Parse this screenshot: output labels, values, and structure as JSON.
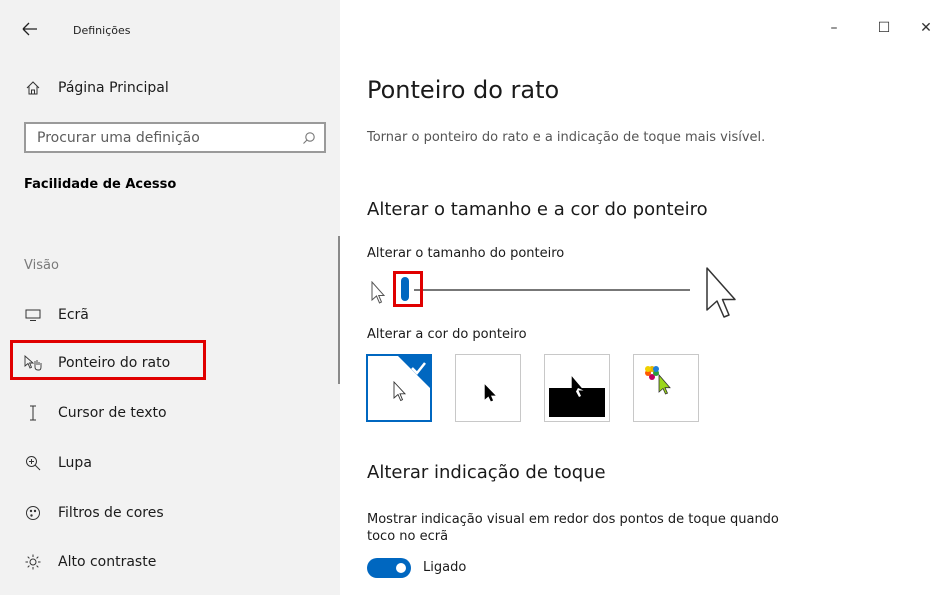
{
  "window": {
    "title": "Definições",
    "controls": {
      "minimize": "–",
      "maximize": "☐",
      "close": "✕"
    }
  },
  "sidebar": {
    "home_label": "Página Principal",
    "search": {
      "placeholder": "Procurar uma definição"
    },
    "section_title": "Facilidade de Acesso",
    "group_label": "Visão",
    "items": [
      {
        "label": "Ecrã",
        "icon": "monitor-icon"
      },
      {
        "label": "Ponteiro do rato",
        "icon": "mouse-pointer-icon",
        "selected": true
      },
      {
        "label": "Cursor de texto",
        "icon": "text-cursor-icon"
      },
      {
        "label": "Lupa",
        "icon": "magnifier-icon"
      },
      {
        "label": "Filtros de cores",
        "icon": "color-filter-icon"
      },
      {
        "label": "Alto contraste",
        "icon": "brightness-icon"
      }
    ]
  },
  "main": {
    "title": "Ponteiro do rato",
    "description": "Tornar o ponteiro do rato e a indicação de toque mais visível.",
    "size_color_section": {
      "heading": "Alterar o tamanho e a cor do ponteiro",
      "size_label": "Alterar o tamanho do ponteiro",
      "size_value": 1,
      "color_label": "Alterar a cor do ponteiro",
      "colors": [
        "white",
        "black",
        "inverted",
        "custom"
      ],
      "selected_color": "white"
    },
    "touch_section": {
      "heading": "Alterar indicação de toque",
      "description_line1": "Mostrar indicação visual em redor dos pontos de toque quando",
      "description_line2": "toco no ecrã",
      "toggle_state": "Ligado"
    }
  },
  "colors": {
    "accent": "#0067c0",
    "highlight": "#e00000"
  }
}
